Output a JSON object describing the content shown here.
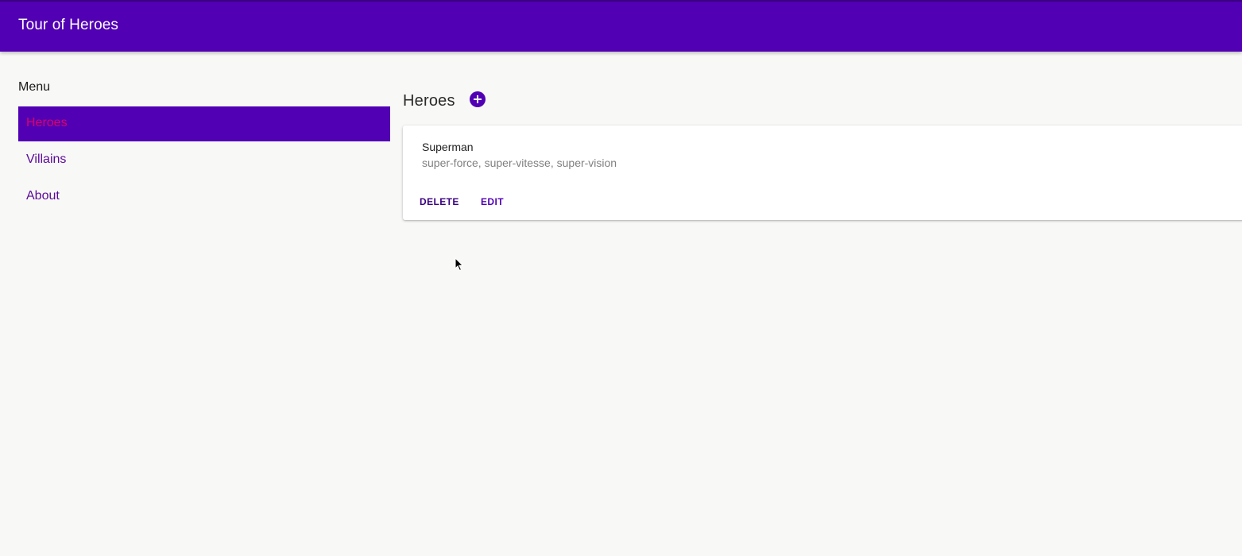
{
  "app": {
    "title": "Tour of Heroes"
  },
  "sidebar": {
    "heading": "Menu",
    "items": [
      {
        "label": "Heroes",
        "active": true
      },
      {
        "label": "Villains",
        "active": false
      },
      {
        "label": "About",
        "active": false
      }
    ]
  },
  "main": {
    "title": "Heroes",
    "add_icon": "plus-circle-icon",
    "heroes": [
      {
        "name": "Superman",
        "powers": "super-force, super-vitesse, super-vision",
        "actions": {
          "delete": "DELETE",
          "edit": "EDIT"
        }
      }
    ]
  },
  "colors": {
    "primary": "#5100b3",
    "accent": "#e0006a",
    "link": "#5b0a99",
    "background": "#f8f8f6"
  }
}
